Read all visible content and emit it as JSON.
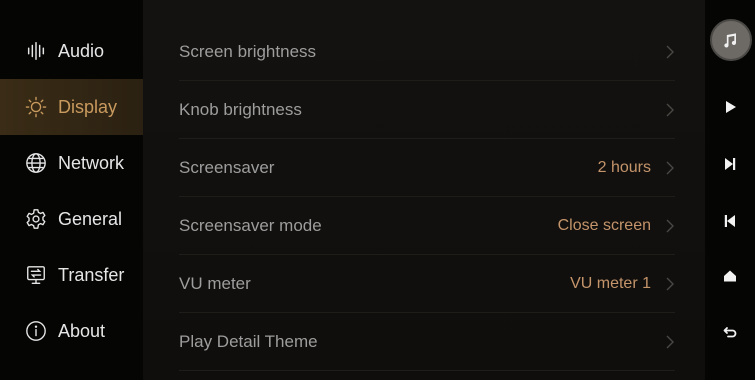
{
  "sidebar": {
    "items": [
      {
        "label": "Audio",
        "icon": "audio-wave-icon",
        "active": false
      },
      {
        "label": "Display",
        "icon": "sun-icon",
        "active": true
      },
      {
        "label": "Network",
        "icon": "globe-icon",
        "active": false
      },
      {
        "label": "General",
        "icon": "gear-icon",
        "active": false
      },
      {
        "label": "Transfer",
        "icon": "transfer-icon",
        "active": false
      },
      {
        "label": "About",
        "icon": "info-icon",
        "active": false
      }
    ]
  },
  "settings": {
    "rows": [
      {
        "label": "Screen brightness",
        "value": ""
      },
      {
        "label": "Knob brightness",
        "value": ""
      },
      {
        "label": "Screensaver",
        "value": "2 hours"
      },
      {
        "label": "Screensaver mode",
        "value": "Close screen"
      },
      {
        "label": "VU meter",
        "value": "VU meter 1"
      },
      {
        "label": "Play Detail Theme",
        "value": ""
      }
    ]
  },
  "controls": {
    "album_icon": "music-note-icon",
    "buttons": [
      "play-icon",
      "next-track-icon",
      "previous-track-icon",
      "home-icon",
      "back-icon"
    ]
  },
  "colors": {
    "accent": "#c99a5e",
    "value_text": "#c4946a",
    "active_bg": "#3a2c16"
  }
}
